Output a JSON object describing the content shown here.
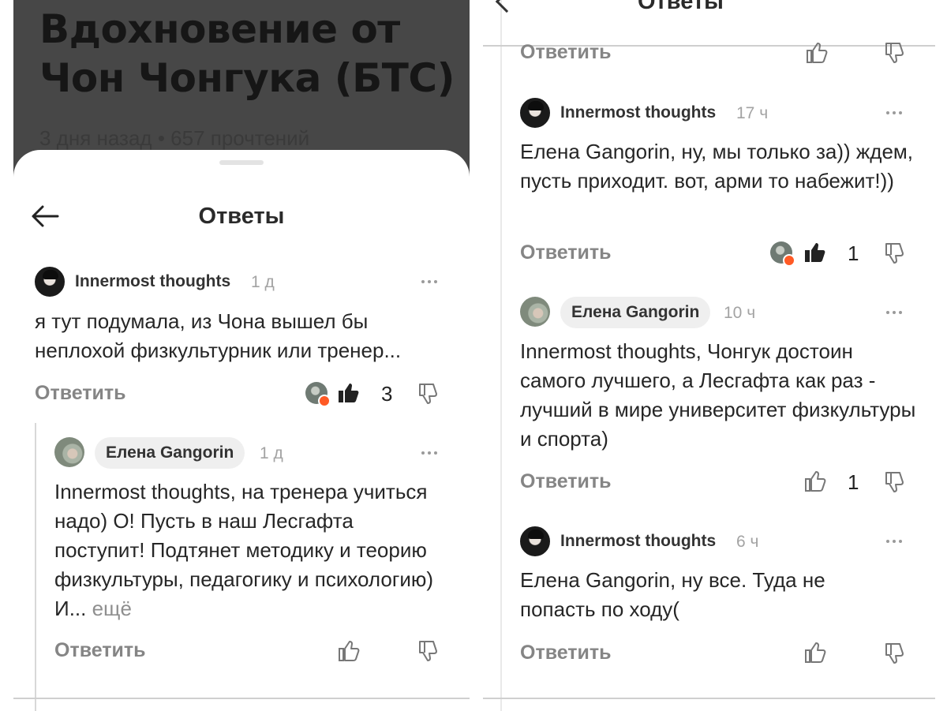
{
  "left_panel": {
    "article": {
      "title": "Вдохновение от Чон Чонгука (БТС)",
      "meta": "3 дня назад • 657 прочтений"
    },
    "sheet_title": "Ответы",
    "comments": [
      {
        "author": "Innermost thoughts",
        "time": "1 д",
        "text": "я тут подумала, из Чона вышел бы неплохой физкультурник или тренер...",
        "reply_label": "Ответить",
        "likes": "3"
      },
      {
        "author": "Елена Gangorin",
        "time": "1 д",
        "text": "Innermost thoughts, на тренера учиться надо) О! Пусть в наш Лесгафта поступит! Подтянет методику и теорию физкультуры, педагогику и психологию) И...",
        "more_label": "ещё",
        "reply_label": "Ответить"
      }
    ]
  },
  "right_panel": {
    "header_title": "Ответы",
    "top_reply_label": "Ответить",
    "comments": [
      {
        "author": "Innermost thoughts",
        "time": "17 ч",
        "text": "Елена Gangorin, ну, мы только за)) ждем, пусть приходит. вот, арми то набежит!))",
        "reply_label": "Ответить",
        "likes": "1"
      },
      {
        "author": "Елена Gangorin",
        "time": "10 ч",
        "text": "Innermost thoughts, Чонгук достоин самого лучшего, а Лесгафта как раз - лучший в мире университет физкультуры и спорта)",
        "reply_label": "Ответить",
        "likes": "1"
      },
      {
        "author": "Innermost thoughts",
        "time": "6 ч",
        "text": "Елена Gangorin, ну все. Туда не попасть по ходу(",
        "reply_label": "Ответить"
      }
    ]
  },
  "colors": {
    "accent_reaction": "#ff5a25",
    "secondary_text": "#858585",
    "chip_bg": "#efefef"
  },
  "icons": [
    "back-arrow-icon",
    "more-icon",
    "like-icon",
    "like-filled-icon",
    "dislike-icon",
    "heart-reaction-icon"
  ]
}
